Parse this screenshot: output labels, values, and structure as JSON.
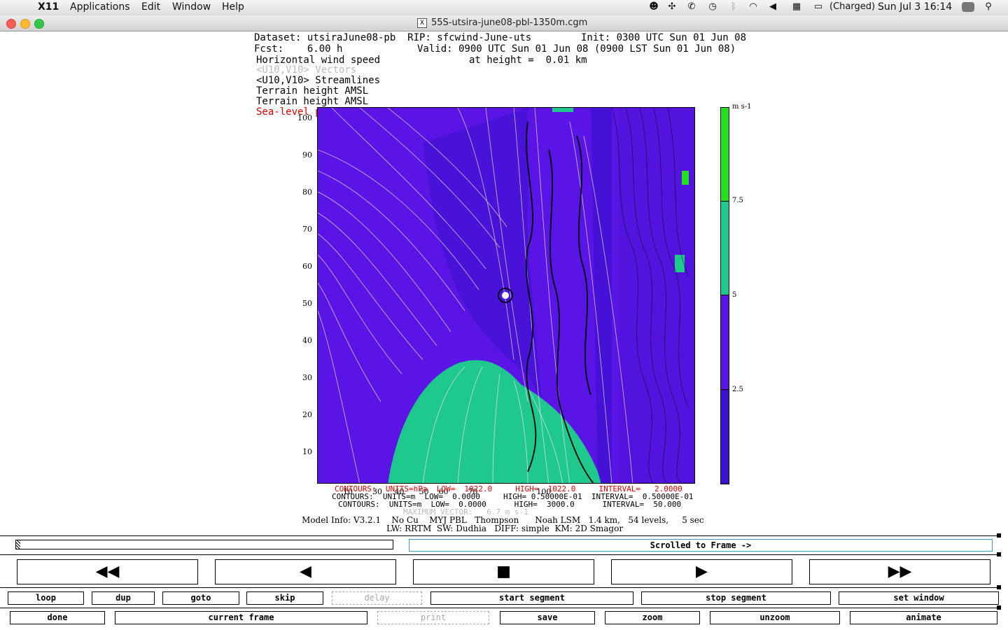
{
  "menubar": {
    "app": "X11",
    "items": [
      "Applications",
      "Edit",
      "Window",
      "Help"
    ],
    "battery": "(Charged)",
    "clock": "Sun Jul 3  16:14"
  },
  "window": {
    "title": "55S-utsira-june08-pbl-1350m.cgm"
  },
  "header": {
    "dataset": "Dataset: utsiraJune08-pb  RIP: sfcwind-June-uts",
    "init": "Init: 0300 UTC Sun 01 Jun 08",
    "fcst": "Fcst:    6.00 h",
    "valid": "Valid: 0900 UTC Sun 01 Jun 08 (0900 LST Sun 01 Jun 08)",
    "field1": "Horizontal wind speed",
    "height": "at height =  0.01 km",
    "field2": "<U10,V10> Vectors",
    "field3": "<U10,V10> Streamlines",
    "field4": "Terrain height AMSL",
    "field5": "Terrain height AMSL",
    "field6": "Sea-level pressure"
  },
  "plot": {
    "yticks": [
      "100",
      "90",
      "80",
      "70",
      "60",
      "50",
      "40",
      "30",
      "20",
      "10"
    ],
    "xticks": [
      "10",
      "20",
      "30",
      "40",
      "50",
      "60",
      "70",
      "80",
      "90",
      "100"
    ],
    "colorbar_unit": "m s-1",
    "colorbar_labels": [
      "7.5",
      "5",
      "2.5"
    ],
    "colors": {
      "bg": "#5a14e6",
      "dark": "#3c10d0",
      "green": "#1fc98e",
      "bright": "#22e020"
    }
  },
  "footer": {
    "c1": "CONTOURS:  UNITS=hPa  LOW=  1022.0     HIGH=  1022.0     INTERVAL=   2.0000",
    "c2": "CONTOURS:  UNITS=m  LOW=  0.0000     HIGH= 0.50000E-01  INTERVAL=  0.50000E-01",
    "c3": "CONTOURS:  UNITS=m  LOW=  0.0000      HIGH=  3000.0      INTERVAL=  50.000",
    "maxvec": "MAXIMUM VECTOR:   6.7 m s-1",
    "model1": "Model Info: V3.2.1    No Cu    MYJ PBL   Thompson      Noah LSM   1.4 km,   54 levels,     5 sec",
    "model2": "LW: RRTM  SW: Dudhia   DIFF: simple  KM: 2D Smagor"
  },
  "controls": {
    "status": "Scrolled to Frame ->",
    "big": [
      "◀◀",
      "◀",
      "■",
      "▶",
      "▶▶"
    ],
    "row1": [
      "loop",
      "dup",
      "goto",
      "skip",
      "delay",
      "start segment",
      "stop segment",
      "set window"
    ],
    "row2": [
      "done",
      "current frame",
      "print",
      "save",
      "zoom",
      "unzoom",
      "animate"
    ]
  }
}
